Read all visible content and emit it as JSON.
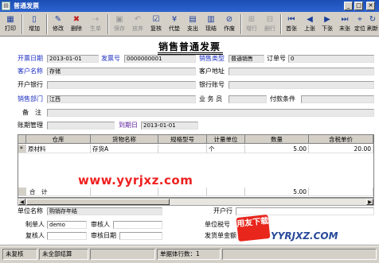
{
  "window": {
    "title": "普通发票",
    "icon": "invoice-app-icon"
  },
  "toolbar": {
    "buttons": [
      {
        "label": "打印",
        "icon": "printer-icon"
      },
      {
        "label": "增加",
        "icon": "add-icon"
      },
      {
        "label": "修改",
        "icon": "edit-icon"
      },
      {
        "label": "删除",
        "icon": "delete-icon"
      },
      {
        "label": "生单",
        "icon": "generate-icon"
      },
      {
        "label": "保存",
        "icon": "save-icon"
      },
      {
        "label": "放弃",
        "icon": "cancel-icon"
      },
      {
        "label": "复核",
        "icon": "review-icon"
      },
      {
        "label": "代垫",
        "icon": "advance-icon"
      },
      {
        "label": "支出",
        "icon": "expense-icon"
      },
      {
        "label": "现结",
        "icon": "cash-settle-icon"
      },
      {
        "label": "作废",
        "icon": "void-icon"
      },
      {
        "label": "增行",
        "icon": "add-row-icon"
      },
      {
        "label": "删行",
        "icon": "delete-row-icon"
      },
      {
        "label": "首张",
        "icon": "first-record-icon"
      },
      {
        "label": "上张",
        "icon": "prev-record-icon"
      },
      {
        "label": "下张",
        "icon": "next-record-icon"
      },
      {
        "label": "末张",
        "icon": "last-record-icon"
      },
      {
        "label": "定位",
        "icon": "locate-icon"
      },
      {
        "label": "刷新",
        "icon": "refresh-icon"
      }
    ]
  },
  "form": {
    "title": "销售普通发票",
    "invoice_date_label": "开票日期",
    "invoice_date": "2013-01-01",
    "invoice_no_label": "发票号",
    "invoice_no": "0000000001",
    "sales_type_label": "销售类型",
    "sales_type": "普通销售",
    "order_no_label": "订单号",
    "order_no": "0",
    "customer_label": "客户名称",
    "customer": "存储",
    "customer_addr_label": "客户地址",
    "customer_addr": "",
    "bank_label": "开户银行",
    "bank": "",
    "bank_account_label": "银行账号",
    "bank_account": "",
    "dept_label": "销售部门",
    "dept": "江西",
    "staff_label": "业 务 员",
    "staff": "",
    "payment_terms_label": "付款条件",
    "payment_terms": "",
    "remark_label": "备　注",
    "remark": "",
    "period_label": "账期管理",
    "period": "",
    "due_date_label": "到期日",
    "due_date": "2013-01-01"
  },
  "grid": {
    "columns": [
      "仓库",
      "货物名称",
      "规格型号",
      "计量单位",
      "数量",
      "含税单价"
    ],
    "rows": [
      {
        "marker": "*",
        "warehouse": "原材料",
        "goods": "存货A",
        "spec": "",
        "unit": "个",
        "qty": "5.00",
        "price": "20.00"
      }
    ],
    "total_label": "合　计",
    "total_qty": "5.00"
  },
  "footer": {
    "company_label": "单位名称",
    "company": "购销存年结",
    "open_bank_label": "开户行",
    "open_bank": "",
    "maker_label": "制单人",
    "maker": "demo",
    "reviewer_label": "审核人",
    "reviewer": "",
    "unit_tax_label": "单位税号",
    "rechecker_label": "复核人",
    "rechecker": "",
    "review_date_label": "审核日期",
    "review_date": "",
    "invoice_amount_label": "发货单金额"
  },
  "watermark": "www.yyrjxz.com",
  "logo": {
    "badge": "用友下载",
    "text": "YYRJXZ.COM"
  },
  "status": {
    "left": "未复核",
    "mid": "未全部结算",
    "right": "单据体行数：1"
  }
}
